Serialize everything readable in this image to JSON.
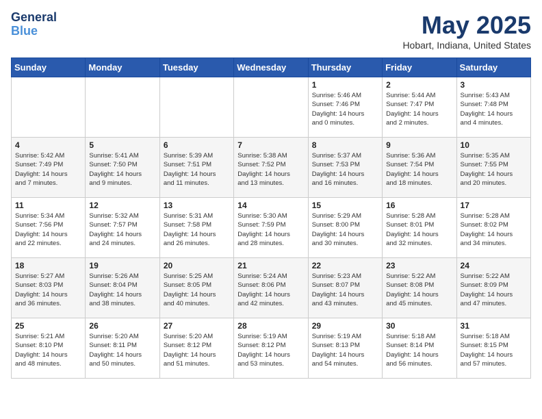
{
  "logo": {
    "line1": "General",
    "line2": "Blue"
  },
  "title": "May 2025",
  "location": "Hobart, Indiana, United States",
  "days_of_week": [
    "Sunday",
    "Monday",
    "Tuesday",
    "Wednesday",
    "Thursday",
    "Friday",
    "Saturday"
  ],
  "weeks": [
    [
      {
        "day": "",
        "info": ""
      },
      {
        "day": "",
        "info": ""
      },
      {
        "day": "",
        "info": ""
      },
      {
        "day": "",
        "info": ""
      },
      {
        "day": "1",
        "info": "Sunrise: 5:46 AM\nSunset: 7:46 PM\nDaylight: 14 hours\nand 0 minutes."
      },
      {
        "day": "2",
        "info": "Sunrise: 5:44 AM\nSunset: 7:47 PM\nDaylight: 14 hours\nand 2 minutes."
      },
      {
        "day": "3",
        "info": "Sunrise: 5:43 AM\nSunset: 7:48 PM\nDaylight: 14 hours\nand 4 minutes."
      }
    ],
    [
      {
        "day": "4",
        "info": "Sunrise: 5:42 AM\nSunset: 7:49 PM\nDaylight: 14 hours\nand 7 minutes."
      },
      {
        "day": "5",
        "info": "Sunrise: 5:41 AM\nSunset: 7:50 PM\nDaylight: 14 hours\nand 9 minutes."
      },
      {
        "day": "6",
        "info": "Sunrise: 5:39 AM\nSunset: 7:51 PM\nDaylight: 14 hours\nand 11 minutes."
      },
      {
        "day": "7",
        "info": "Sunrise: 5:38 AM\nSunset: 7:52 PM\nDaylight: 14 hours\nand 13 minutes."
      },
      {
        "day": "8",
        "info": "Sunrise: 5:37 AM\nSunset: 7:53 PM\nDaylight: 14 hours\nand 16 minutes."
      },
      {
        "day": "9",
        "info": "Sunrise: 5:36 AM\nSunset: 7:54 PM\nDaylight: 14 hours\nand 18 minutes."
      },
      {
        "day": "10",
        "info": "Sunrise: 5:35 AM\nSunset: 7:55 PM\nDaylight: 14 hours\nand 20 minutes."
      }
    ],
    [
      {
        "day": "11",
        "info": "Sunrise: 5:34 AM\nSunset: 7:56 PM\nDaylight: 14 hours\nand 22 minutes."
      },
      {
        "day": "12",
        "info": "Sunrise: 5:32 AM\nSunset: 7:57 PM\nDaylight: 14 hours\nand 24 minutes."
      },
      {
        "day": "13",
        "info": "Sunrise: 5:31 AM\nSunset: 7:58 PM\nDaylight: 14 hours\nand 26 minutes."
      },
      {
        "day": "14",
        "info": "Sunrise: 5:30 AM\nSunset: 7:59 PM\nDaylight: 14 hours\nand 28 minutes."
      },
      {
        "day": "15",
        "info": "Sunrise: 5:29 AM\nSunset: 8:00 PM\nDaylight: 14 hours\nand 30 minutes."
      },
      {
        "day": "16",
        "info": "Sunrise: 5:28 AM\nSunset: 8:01 PM\nDaylight: 14 hours\nand 32 minutes."
      },
      {
        "day": "17",
        "info": "Sunrise: 5:28 AM\nSunset: 8:02 PM\nDaylight: 14 hours\nand 34 minutes."
      }
    ],
    [
      {
        "day": "18",
        "info": "Sunrise: 5:27 AM\nSunset: 8:03 PM\nDaylight: 14 hours\nand 36 minutes."
      },
      {
        "day": "19",
        "info": "Sunrise: 5:26 AM\nSunset: 8:04 PM\nDaylight: 14 hours\nand 38 minutes."
      },
      {
        "day": "20",
        "info": "Sunrise: 5:25 AM\nSunset: 8:05 PM\nDaylight: 14 hours\nand 40 minutes."
      },
      {
        "day": "21",
        "info": "Sunrise: 5:24 AM\nSunset: 8:06 PM\nDaylight: 14 hours\nand 42 minutes."
      },
      {
        "day": "22",
        "info": "Sunrise: 5:23 AM\nSunset: 8:07 PM\nDaylight: 14 hours\nand 43 minutes."
      },
      {
        "day": "23",
        "info": "Sunrise: 5:22 AM\nSunset: 8:08 PM\nDaylight: 14 hours\nand 45 minutes."
      },
      {
        "day": "24",
        "info": "Sunrise: 5:22 AM\nSunset: 8:09 PM\nDaylight: 14 hours\nand 47 minutes."
      }
    ],
    [
      {
        "day": "25",
        "info": "Sunrise: 5:21 AM\nSunset: 8:10 PM\nDaylight: 14 hours\nand 48 minutes."
      },
      {
        "day": "26",
        "info": "Sunrise: 5:20 AM\nSunset: 8:11 PM\nDaylight: 14 hours\nand 50 minutes."
      },
      {
        "day": "27",
        "info": "Sunrise: 5:20 AM\nSunset: 8:12 PM\nDaylight: 14 hours\nand 51 minutes."
      },
      {
        "day": "28",
        "info": "Sunrise: 5:19 AM\nSunset: 8:12 PM\nDaylight: 14 hours\nand 53 minutes."
      },
      {
        "day": "29",
        "info": "Sunrise: 5:19 AM\nSunset: 8:13 PM\nDaylight: 14 hours\nand 54 minutes."
      },
      {
        "day": "30",
        "info": "Sunrise: 5:18 AM\nSunset: 8:14 PM\nDaylight: 14 hours\nand 56 minutes."
      },
      {
        "day": "31",
        "info": "Sunrise: 5:18 AM\nSunset: 8:15 PM\nDaylight: 14 hours\nand 57 minutes."
      }
    ]
  ]
}
